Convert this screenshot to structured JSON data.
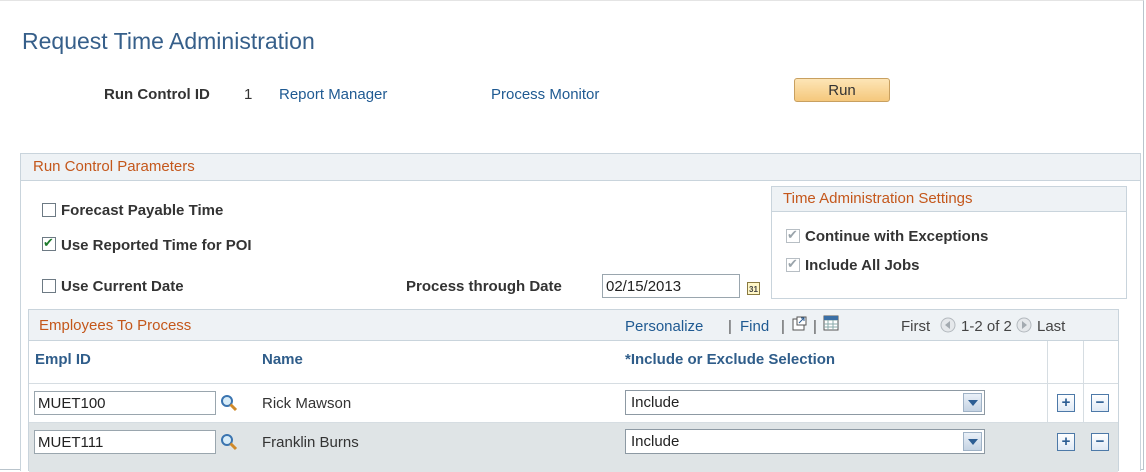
{
  "page": {
    "title": "Request Time Administration"
  },
  "header": {
    "run_control_label": "Run Control ID",
    "run_control_value": "1",
    "report_manager": "Report Manager",
    "process_monitor": "Process Monitor",
    "run_button": "Run"
  },
  "params": {
    "title": "Run Control Parameters",
    "forecast_label": "Forecast Payable Time",
    "forecast_checked": false,
    "use_reported_label": "Use Reported Time for POI",
    "use_reported_checked": true,
    "use_current_date_label": "Use Current Date",
    "use_current_date_checked": false,
    "process_through_label": "Process through Date",
    "process_through_value": "02/15/2013",
    "calendar_icon_text": "31"
  },
  "ta_settings": {
    "title": "Time Administration Settings",
    "continue_label": "Continue with Exceptions",
    "continue_checked": true,
    "include_jobs_label": "Include All Jobs",
    "include_jobs_checked": true
  },
  "employees": {
    "title": "Employees To Process",
    "personalize": "Personalize",
    "pipe1": "|",
    "find": "Find",
    "pipe2": "|",
    "pipe3": "|",
    "first": "First",
    "range": "1-2 of 2",
    "last": "Last",
    "columns": {
      "empl_id": "Empl ID",
      "name": "Name",
      "include": "*Include or Exclude Selection"
    },
    "rows": [
      {
        "empl_id": "MUET100",
        "name": "Rick Mawson",
        "selection": "Include"
      },
      {
        "empl_id": "MUET111",
        "name": "Franklin Burns",
        "selection": "Include"
      }
    ],
    "add_symbol": "+",
    "remove_symbol": "−"
  },
  "colors": {
    "accent_orange": "#c4571b",
    "link_blue": "#1f5a92",
    "title_blue": "#365f8a"
  }
}
